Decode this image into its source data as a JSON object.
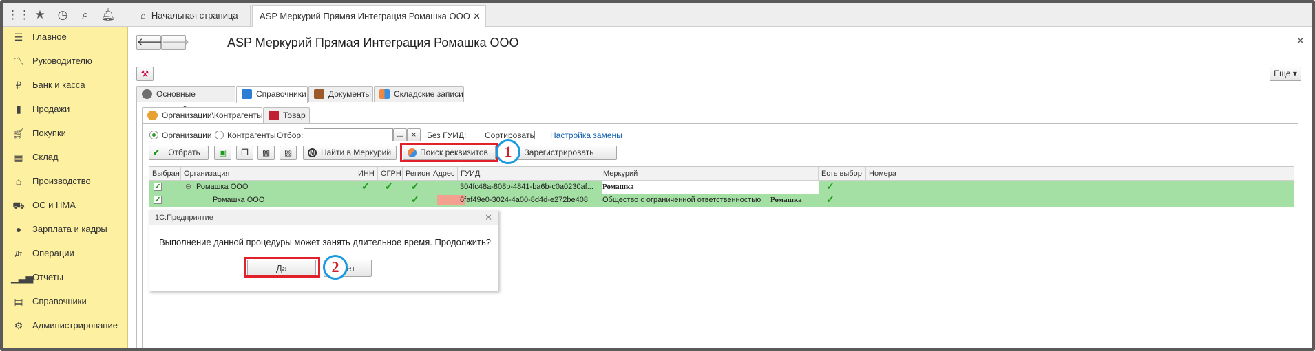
{
  "topbar": {
    "tabs": [
      {
        "label": "Начальная страница"
      },
      {
        "label": "ASP Меркурий Прямая Интеграция Ромашка ООО"
      }
    ]
  },
  "sidebar": {
    "items": [
      {
        "label": "Главное",
        "icon": "menu-icon"
      },
      {
        "label": "Руководителю",
        "icon": "chart-line-icon"
      },
      {
        "label": "Банк и касса",
        "icon": "ruble-icon"
      },
      {
        "label": "Продажи",
        "icon": "shopping-bag-icon"
      },
      {
        "label": "Покупки",
        "icon": "cart-icon"
      },
      {
        "label": "Склад",
        "icon": "warehouse-icon"
      },
      {
        "label": "Производство",
        "icon": "factory-icon"
      },
      {
        "label": "ОС и НМА",
        "icon": "truck-icon"
      },
      {
        "label": "Зарплата и кадры",
        "icon": "person-icon"
      },
      {
        "label": "Операции",
        "icon": "dt-kt-icon"
      },
      {
        "label": "Отчеты",
        "icon": "bar-chart-icon"
      },
      {
        "label": "Справочники",
        "icon": "book-icon"
      },
      {
        "label": "Администрирование",
        "icon": "gear-icon"
      }
    ]
  },
  "page": {
    "title": "ASP Меркурий Прямая Интеграция Ромашка ООО",
    "more_label": "Еще ▾"
  },
  "tabs_top": [
    {
      "label": "Основные настройки"
    },
    {
      "label": "Справочники"
    },
    {
      "label": "Документы"
    },
    {
      "label": "Складские записи"
    }
  ],
  "tabs_sub": [
    {
      "label": "Организации\\Контрагенты"
    },
    {
      "label": "Товар"
    }
  ],
  "filter": {
    "radio_org": "Организации",
    "radio_contr": "Контрагенты",
    "otbor_label": "Отбор:",
    "otbor_value": "",
    "ellipsis": "...",
    "clear": "×",
    "no_guid": "Без ГУИД:",
    "sort": "Сортировать:",
    "replace_link": "Настройка замены"
  },
  "toolbar": {
    "select": "Отбрать",
    "find_mercury": "Найти в Меркурий",
    "search_req": "Поиск реквизитов",
    "register": "Зарегистрировать"
  },
  "grid": {
    "headers": [
      "Выбран",
      "Организация",
      "ИНН",
      "ОГРН",
      "Регион",
      "Адрес",
      "ГУИД",
      "Меркурий",
      "Есть выбор",
      "Номера"
    ],
    "rows": [
      {
        "org": "Ромашка ООО",
        "guid": "304fc48a-808b-4841-ba6b-c0a0230af...",
        "mercury": "Ромашка",
        "extra": ""
      },
      {
        "org": "Ромашка ООО",
        "guid": "6faf49e0-3024-4a00-8d4d-e272be408...",
        "mercury": "Общество с ограниченной ответственностью",
        "extra": "Ромашка"
      }
    ]
  },
  "dialog": {
    "title": "1С:Предприятие",
    "message": "Выполнение данной процедуры может занять длительное время. Продолжить?",
    "yes": "Да",
    "no": "Нет"
  },
  "callouts": {
    "one": "1",
    "two": "2"
  },
  "colors": {
    "sidebar": "#fdf0a0",
    "row_green": "#a4e0a4",
    "address_red": "#f4a090",
    "highlight_red": "#e0202a",
    "callout_blue": "#1a9be0"
  }
}
